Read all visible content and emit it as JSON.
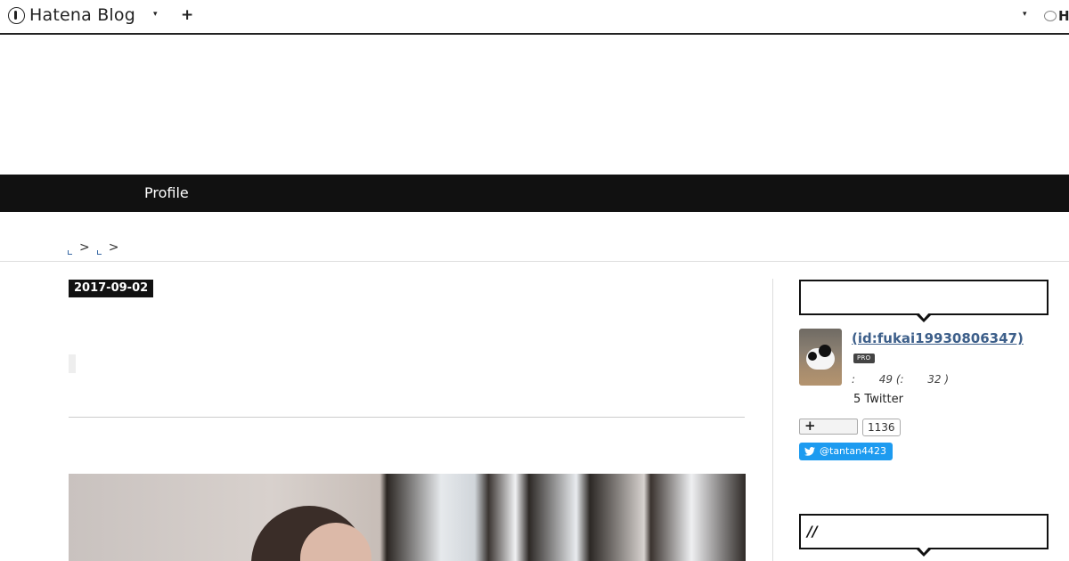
{
  "topbar": {
    "logo_text": "Hatena Blog",
    "add_symbol": "+",
    "menu_caret": "▾",
    "right_caret": "▾",
    "right_logo_text": "H"
  },
  "nav": {
    "profile_label": "Profile"
  },
  "breadcrumb": {
    "sep1": ">",
    "sep2": ">"
  },
  "article": {
    "date": "2017-09-02"
  },
  "sidebar": {
    "profile": {
      "id_text": " (id:fukai19930806347)",
      "badge": "PRO",
      "stats_text": ":       49 (:       32 )",
      "twitter_text": "5 Twitter",
      "bookmark_count": "1136",
      "follow_label": "@tantan4423"
    },
    "second_module_title": "//"
  },
  "colors": {
    "nav_background": "#111111",
    "link": "#3d5f8a",
    "twitter_blue": "#1d9bf0"
  }
}
